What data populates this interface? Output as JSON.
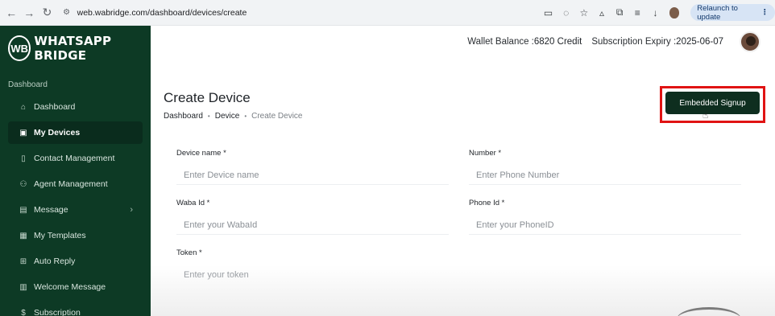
{
  "browser": {
    "url": "web.wabridge.com/dashboard/devices/create",
    "relaunch_label": "Relaunch to update",
    "icons": [
      "back-arrow-icon",
      "forward-arrow-icon",
      "reload-icon",
      "site-settings-icon",
      "cast-icon",
      "eye-off-icon",
      "star-icon",
      "extensions-icon",
      "puzzle-icon",
      "media-icon",
      "download-icon",
      "profile-icon",
      "more-icon"
    ]
  },
  "sidebar": {
    "logo_mark": "WB",
    "logo_text": "WHATSAPP BRIDGE",
    "section_label": "Dashboard",
    "items": [
      {
        "label": "Dashboard",
        "icon": "home-icon"
      },
      {
        "label": "My Devices",
        "icon": "devices-icon"
      },
      {
        "label": "Contact Management",
        "icon": "contact-icon"
      },
      {
        "label": "Agent Management",
        "icon": "agents-icon"
      },
      {
        "label": "Message",
        "icon": "message-icon"
      },
      {
        "label": "My Templates",
        "icon": "template-icon"
      },
      {
        "label": "Auto Reply",
        "icon": "auto-reply-icon"
      },
      {
        "label": "Welcome Message",
        "icon": "welcome-icon"
      },
      {
        "label": "Subscription",
        "icon": "subscription-icon"
      }
    ],
    "active_item": "My Devices"
  },
  "header": {
    "wallet_label": "Wallet Balance :",
    "wallet_value": "6820 Credit",
    "expiry_label": "Subscription Expiry :",
    "expiry_value": "2025-06-07"
  },
  "page": {
    "title": "Create Device",
    "breadcrumb": [
      "Dashboard",
      "Device",
      "Create Device"
    ],
    "embedded_signup_label": "Embedded Signup"
  },
  "form": {
    "device_name": {
      "label": "Device name *",
      "placeholder": "Enter Device name"
    },
    "number": {
      "label": "Number *",
      "placeholder": "Enter Phone Number"
    },
    "waba_id": {
      "label": "Waba Id *",
      "placeholder": "Enter your WabaId"
    },
    "phone_id": {
      "label": "Phone Id *",
      "placeholder": "Enter your PhoneID"
    },
    "token": {
      "label": "Token *",
      "placeholder": "Enter your token"
    }
  }
}
